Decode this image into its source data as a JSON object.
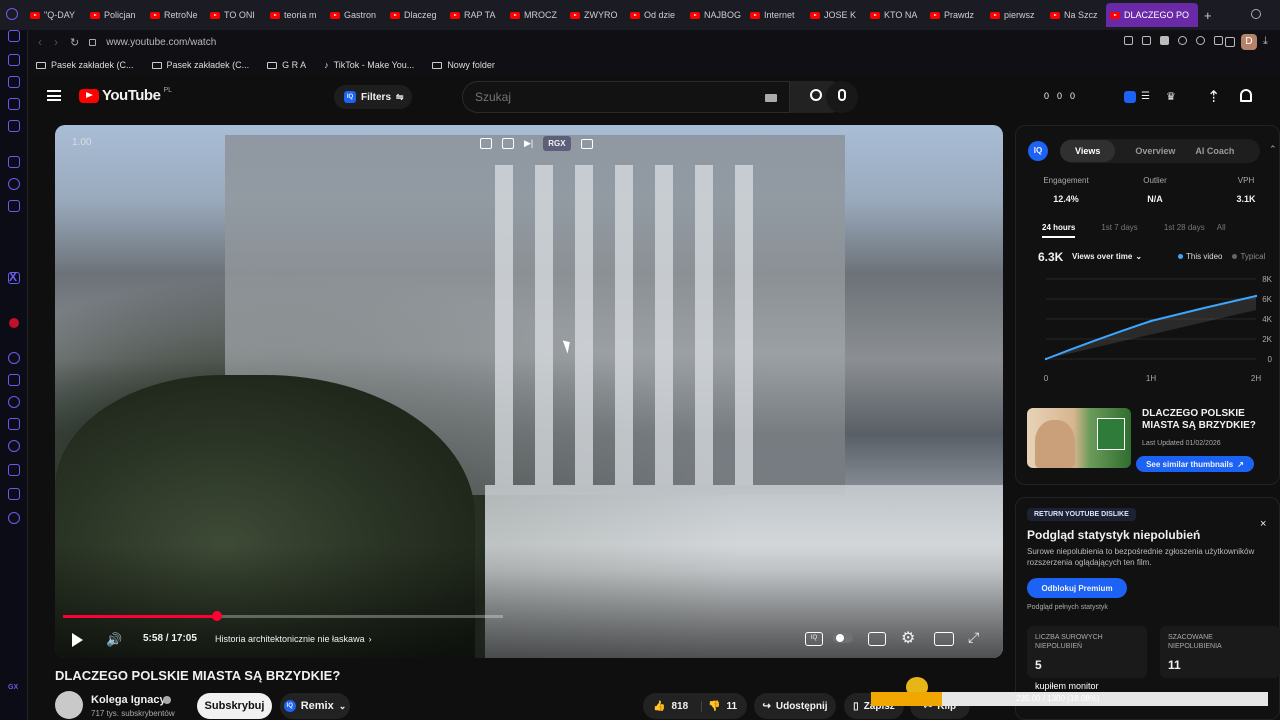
{
  "browser": {
    "tabs": [
      "\"Q-DAY",
      "Policjan",
      "RetroNe",
      "TO ONI",
      "teoria m",
      "Gastron",
      "Dlaczeg",
      "RAP TA",
      "MROCZ",
      "ZWYRO",
      "Od dzie",
      "NAJBOG",
      "Internet",
      "JOSE K",
      "KTO NA",
      "Prawdz",
      "pierwsz",
      "Na Szcz"
    ],
    "active_tab": "DLACZEGO PO",
    "url": "www.youtube.com/watch",
    "profile_initial": "D",
    "bookmarks": [
      "Pasek zakładek (C...",
      "Pasek zakładek (C...",
      "G R A",
      "TikTok - Make You...",
      "Nowy folder"
    ]
  },
  "youtube": {
    "logo_text": "YouTube",
    "region": "PL",
    "filters_label": "Filters",
    "search_placeholder": "Szukaj",
    "header_counters": [
      "0",
      "0",
      "0"
    ]
  },
  "player": {
    "speed": "1.00",
    "rgx_label": "RGX",
    "time": "5:58 / 17:05",
    "chapter": "Historia architektonicznie nie łaskawa",
    "progress": 0.35
  },
  "video_info": {
    "title": "DLACZEGO POLSKIE MIASTA SĄ BRZYDKIE?",
    "channel": "Kolega Ignacy",
    "subscribers": "717 tys. subskrybentów",
    "subscribe_label": "Subskrybuj",
    "remix_label": "Remix",
    "likes": "818",
    "dislikes": "11",
    "share_label": "Udostępnij",
    "save_label": "Zapisz",
    "clip_label": "Klip"
  },
  "vidiq": {
    "badge": "IQ",
    "tabs": [
      "Views",
      "Overview",
      "AI Coach"
    ],
    "metrics": [
      {
        "label": "Engagement",
        "value": "12.4%"
      },
      {
        "label": "Outlier",
        "value": "N/A"
      },
      {
        "label": "VPH",
        "value": "3.1K"
      }
    ],
    "ranges": [
      "24 hours",
      "1st 7 days",
      "1st 28 days",
      "All"
    ],
    "views": "6.3K",
    "views_dropdown": "Views over time",
    "legend": [
      "This video",
      "Typical"
    ],
    "y_ticks": [
      "8K",
      "6K",
      "4K",
      "2K",
      "0"
    ],
    "x_ticks": [
      "0",
      "1H",
      "2H"
    ],
    "thumb_title": "DLACZEGO POLSKIE MIASTA SĄ BRZYDKIE?",
    "updated": "Last Updated 01/02/2026",
    "similar_label": "See similar thumbnails"
  },
  "chart_data": {
    "type": "line",
    "x": [
      "0",
      "1H",
      "2H"
    ],
    "series": [
      {
        "name": "This video",
        "values": [
          0,
          3800,
          6300
        ]
      }
    ],
    "ylim": [
      0,
      8000
    ],
    "yticks": [
      "8K",
      "6K",
      "4K",
      "2K",
      "0"
    ],
    "color": "#3ea6ff"
  },
  "dislike_panel": {
    "header": "RETURN YOUTUBE DISLIKE",
    "title": "Podgląd statystyk niepolubień",
    "desc": "Surowe niepolubienia to bezpośrednie zgłoszenia użytkowników rozszerzenia oglądających ten film.",
    "button": "Odblokuj Premium",
    "note": "Podgląd pełnych statystyk",
    "raw_label": "LICZBA SUROWYCH NIEPOLUBIEŃ",
    "raw_value": "5",
    "est_label": "SZACOWANE NIEPOLUBIENIA",
    "est_value": "11",
    "comment": "kupiłem monitor",
    "loading_text": "235.00 / 1300 (18.08%)"
  },
  "colors": {
    "accent": "#3ea6ff",
    "brand_red": "#ff0000",
    "vidiq_blue": "#1c62f5",
    "tab_purple": "#6a2aa8"
  }
}
